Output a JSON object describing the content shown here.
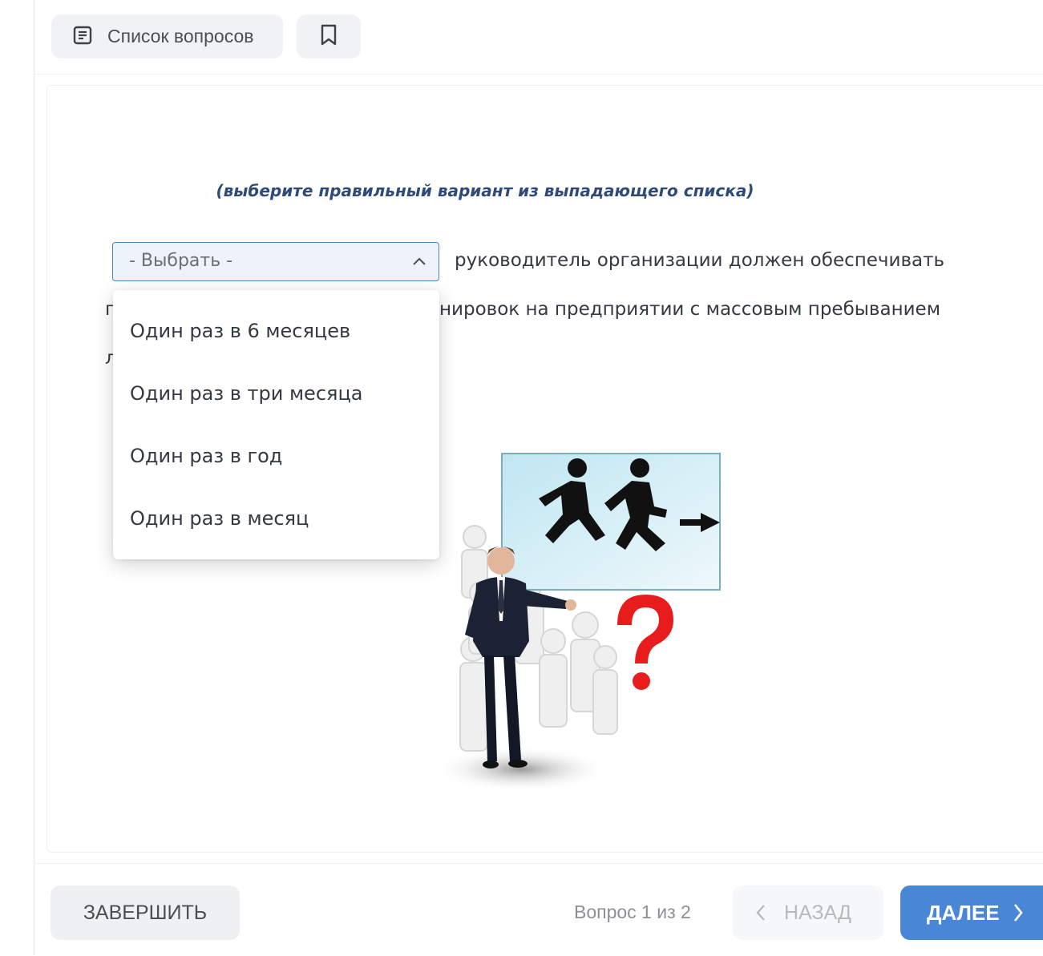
{
  "toolbar": {
    "question_list_label": "Список вопросов",
    "question_list_icon": "document-list-icon",
    "bookmark_icon": "bookmark-icon"
  },
  "question": {
    "hint": "(выберите правильный вариант из выпадающего списка)",
    "select_value": "- Выбрать -",
    "text_line1": "руководитель организации должен обеспечивать",
    "text_line2": "проведение тренировок на предприятии с массовым пребыванием",
    "text_line3": "людей?",
    "visible_line2_start": "г",
    "visible_line2_end": "нировок на предприятии с массовым пребыванием",
    "visible_line3_start": "л"
  },
  "dropdown": {
    "options": [
      "Один раз в 6 месяцев",
      "Один раз в три месяца",
      "Один раз в год",
      "Один раз в месяц"
    ]
  },
  "footer": {
    "finish_label": "ЗАВЕРШИТЬ",
    "counter": "Вопрос 1 из 2",
    "back_label": "НАЗАД",
    "next_label": "ДАЛЕЕ"
  },
  "colors": {
    "accent": "#4a86d6",
    "hint_text": "#2f4a78",
    "select_border": "#4f7fc6"
  }
}
